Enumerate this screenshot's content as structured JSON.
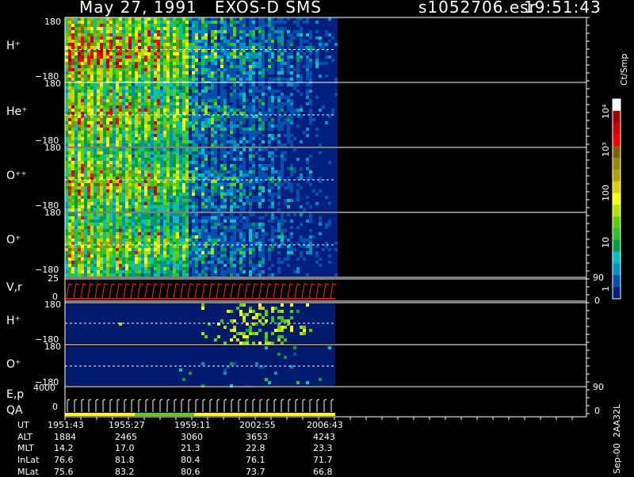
{
  "header": {
    "title": "May 27, 1991   EXOS-D SMS",
    "file": "s1052706.esr",
    "time": "19:51:43"
  },
  "colorbar": {
    "unit": "Ct/Smp",
    "ticks": [
      "10⁴",
      "10³",
      "100",
      "10",
      "1"
    ],
    "colors": [
      "#ffffff",
      "#a00000",
      "#cc0000",
      "#ff0000",
      "#806000",
      "#9a8a00",
      "#b0a000",
      "#d8d000",
      "#ffff00",
      "#b0e000",
      "#60d000",
      "#30c030",
      "#00a040",
      "#00c0c0",
      "#0090c0",
      "#0050b0",
      "#002080"
    ]
  },
  "panels": [
    {
      "name": "h-plus-pitch",
      "label": "H⁺",
      "ymax": "180",
      "ymin": "−180"
    },
    {
      "name": "he-plus-pitch",
      "label": "He⁺",
      "ymax": "180",
      "ymin": "−180"
    },
    {
      "name": "o-plus-plus-pitch",
      "label": "O⁺⁺",
      "ymax": "180",
      "ymin": "−180"
    },
    {
      "name": "o-plus-pitch",
      "label": "O⁺",
      "ymax": "180",
      "ymin": "−180"
    },
    {
      "name": "vr-panel",
      "label": "V,r",
      "ymax": "25",
      "ymin": "0",
      "right_top": "90",
      "right_bottom": "0"
    },
    {
      "name": "h-plus-pitch-2",
      "label": "H⁺",
      "ymax": "180",
      "ymin": "−180"
    },
    {
      "name": "o-plus-pitch-2",
      "label": "O⁺",
      "ymax": "180",
      "ymin": "−180"
    },
    {
      "name": "ep-qa-panel",
      "label": "E,p",
      "label2": "QA",
      "ymax": "4000",
      "ymin": "0",
      "right_top": "90",
      "right_bottom": "0"
    }
  ],
  "footer": {
    "row_labels": [
      "UT",
      "ALT",
      "MLT",
      "InLat",
      "MLat"
    ],
    "columns": [
      {
        "UT": "1951:43",
        "ALT": "1884",
        "MLT": "14.2",
        "InLat": "76.6",
        "MLat": "75.6"
      },
      {
        "UT": "1955:27",
        "ALT": "2465",
        "MLT": "17.0",
        "InLat": "81.8",
        "MLat": "83.2"
      },
      {
        "UT": "1959:11",
        "ALT": "3060",
        "MLT": "21.3",
        "InLat": "80.4",
        "MLat": "80.6"
      },
      {
        "UT": "2002:55",
        "ALT": "3653",
        "MLT": "22.8",
        "InLat": "76.1",
        "MLat": "73.7"
      },
      {
        "UT": "2006:43",
        "ALT": "4243",
        "MLT": "23.3",
        "InLat": "71.7",
        "MLat": "66.8"
      }
    ],
    "side_note": "Sep-00  2AA32L"
  },
  "chart_data": {
    "type": "heatmap",
    "title": "May 27, 1991   EXOS-D SMS",
    "x": [
      "1951:43",
      "1955:27",
      "1959:11",
      "2002:55",
      "2006:43"
    ],
    "series": [
      {
        "name": "H⁺",
        "ylim": [
          -180,
          180
        ],
        "intensity": "high, red bands early, decreasing"
      },
      {
        "name": "He⁺",
        "ylim": [
          -180,
          180
        ],
        "intensity": "moderate, yellow-green, decreasing"
      },
      {
        "name": "O⁺⁺",
        "ylim": [
          -180,
          180
        ],
        "intensity": "moderate, yellow-green, decreasing"
      },
      {
        "name": "O⁺",
        "ylim": [
          -180,
          180
        ],
        "intensity": "moderate, yellow-green, decreasing"
      },
      {
        "name": "V,r",
        "ylim": [
          0,
          25
        ]
      },
      {
        "name": "H⁺",
        "ylim": [
          -180,
          180
        ],
        "intensity": "low, sparse near 2002:55"
      },
      {
        "name": "O⁺",
        "ylim": [
          -180,
          180
        ],
        "intensity": "very low"
      },
      {
        "name": "E,p",
        "ylim": [
          0,
          4000
        ]
      }
    ],
    "zlabel": "Ct/Smp",
    "zlim": [
      1,
      10000
    ],
    "z_scale": "log"
  }
}
